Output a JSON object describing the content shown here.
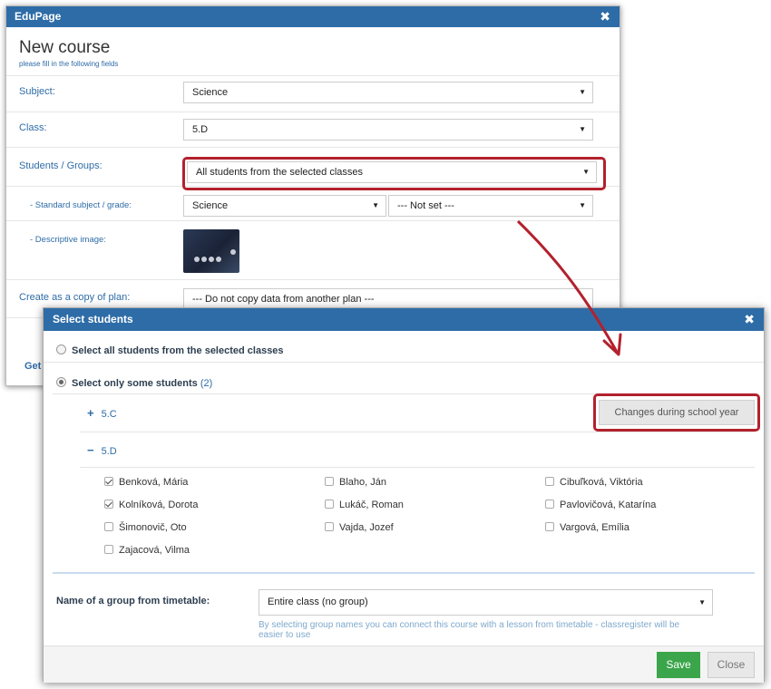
{
  "back_dialog": {
    "app_title": "EduPage",
    "title": "New course",
    "subtitle": "please fill in the following fields",
    "fields": {
      "subject": {
        "label": "Subject:",
        "value": "Science"
      },
      "class": {
        "label": "Class:",
        "value": "5.D"
      },
      "students": {
        "label": "Students / Groups:",
        "value": "All students from the selected classes"
      },
      "standard": {
        "label": "- Standard subject / grade:",
        "value": "Science",
        "grade_value": "--- Not set ---"
      },
      "image": {
        "label": "- Descriptive image:"
      },
      "copy_plan": {
        "label": "Create as a copy of plan:",
        "value": "--- Do not copy data from another plan ---"
      }
    },
    "get_link": "Get"
  },
  "select_dialog": {
    "title": "Select students",
    "option_all": "Select all students from the selected classes",
    "option_some": "Select only some students",
    "option_some_count": "(2)",
    "classes": [
      {
        "name": "5.C",
        "toggle": "+"
      },
      {
        "name": "5.D",
        "toggle": "−"
      }
    ],
    "changes_button": "Changes during school year",
    "students": [
      {
        "name": "Benková, Mária",
        "checked": true
      },
      {
        "name": "Blaho, Ján",
        "checked": false
      },
      {
        "name": "Cibuľková, Viktória",
        "checked": false
      },
      {
        "name": "Kolníková, Dorota",
        "checked": true
      },
      {
        "name": "Lukáč, Roman",
        "checked": false
      },
      {
        "name": "Pavlovičová, Katarína",
        "checked": false
      },
      {
        "name": "Šimonovič, Oto",
        "checked": false
      },
      {
        "name": "Vajda, Jozef",
        "checked": false
      },
      {
        "name": "Vargová, Emília",
        "checked": false
      },
      {
        "name": "Zajacová, Vilma",
        "checked": false
      }
    ],
    "group_label": "Name of a group from timetable:",
    "group_value": "Entire class (no group)",
    "group_help": "By selecting group names you can connect this course with a lesson from timetable - classregister will be easier to use",
    "save_label": "Save",
    "close_label": "Close"
  },
  "colors": {
    "titlebar": "#2e6ca7",
    "highlight": "#b3212d",
    "save": "#3aa54a"
  }
}
